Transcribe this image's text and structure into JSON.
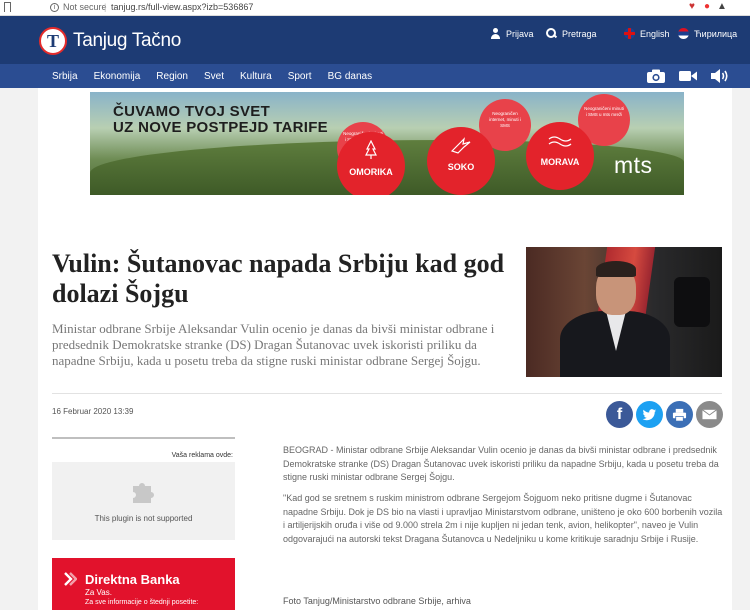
{
  "browser": {
    "security_label": "Not secure",
    "separator": "|",
    "url": "tanjug.rs/full-view.aspx?izb=536867"
  },
  "header": {
    "logo_mark": "T",
    "logo_text": "Tanjug Tačno",
    "login_label": "Prijava",
    "search_label": "Pretraga",
    "english_label": "English",
    "cyrillic_label": "Ћирилица"
  },
  "nav": {
    "items": [
      "Srbija",
      "Ekonomija",
      "Region",
      "Svet",
      "Kultura",
      "Sport",
      "BG danas"
    ]
  },
  "ad": {
    "headline_line1": "ČUVAMO TVOJ SVET",
    "headline_line2": "UZ NOVE POSTPEJD TARIFE",
    "circles": [
      {
        "small": "Neograničeni minuti i SMS + do 12 GB interneta",
        "name": "OMORIKA"
      },
      {
        "small": "Neograničen internet, minuti i SMS",
        "name": "SOKO"
      },
      {
        "small": "Neograničeni minuti i SMS u mts mreži",
        "name": "MORAVA"
      }
    ],
    "brand": "mts"
  },
  "article": {
    "title": "Vulin: Šutanovac napada Srbiju kad god dolazi Šojgu",
    "lead": "Ministar odbrane Srbije Aleksandar Vulin ocenio je danas da bivši ministar odbrane i predsednik Demokratske stranke (DS) Dragan Šutanovac uvek iskoristi priliku da napadne Srbiju, kada u posetu treba da stigne ruski ministar odbrane Sergej Šojgu.",
    "date": "16 Februar 2020 13:39",
    "paragraph1": "BEOGRAD - Ministar odbrane Srbije Aleksandar Vulin ocenio je danas da bivši ministar odbrane i predsednik Demokratske stranke (DS) Dragan Šutanovac uvek iskoristi priliku da napadne Srbiju, kada u posetu treba da stigne ruski ministar odbrane Sergej Šojgu.",
    "paragraph2": "\"Kad god se sretnem s ruskim ministrom odbrane Sergejom Šojguom neko pritisne dugme i Šutanovac napadne Srbiju. Dok je DS bio na vlasti i upravljao Ministarstvom odbrane, uništeno je oko 600 borbenih vozila i artiljerijskih oruđa i više od 9.000 strela 2m i nije kupljen ni jedan tenk, avion, helikopter\", naveo je Vulin odgovarajući na autorski tekst Dragana Šutanovca u Nedeljniku u kome kritikuje saradnju Srbije i Rusije.",
    "photo_credit": "Foto Tanjug/Ministarstvo odbrane Srbije, arhiva"
  },
  "share": {
    "facebook": "f",
    "colors": {
      "facebook": "#3b5998",
      "twitter": "#1da1f2",
      "print": "#3b6fb6",
      "email": "#8a8a8a"
    }
  },
  "sidebar": {
    "ad_label": "Vaša reklama ovde:",
    "plugin_text": "This plugin is not supported",
    "bank_name": "Direktna Banka",
    "bank_sub": "Za Vas.",
    "bank_info": "Za sve informacije o štednji posetite:"
  },
  "colors": {
    "header": "#1d3b74",
    "nav": "#2b4d92",
    "accent_red": "#e3232b"
  }
}
